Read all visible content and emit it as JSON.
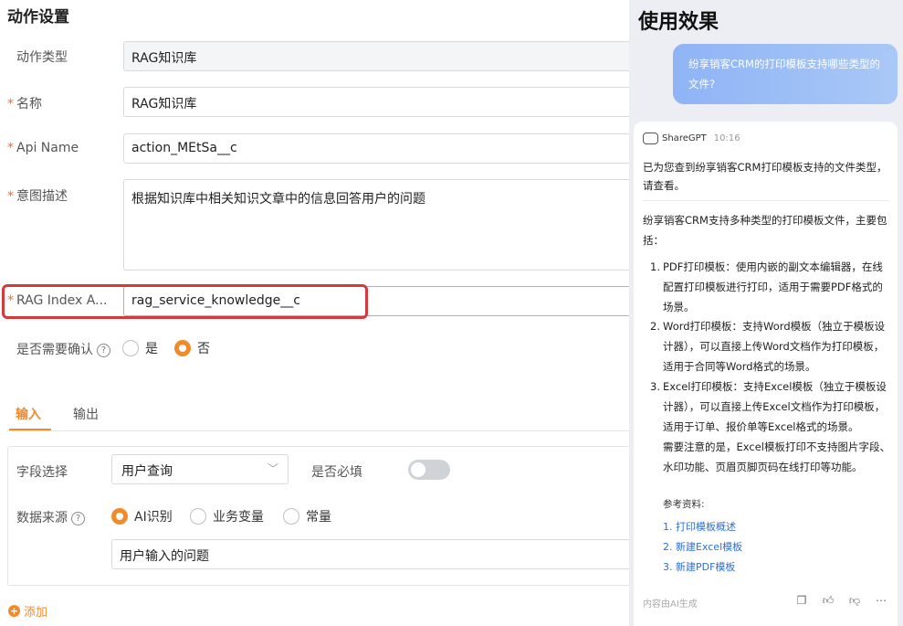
{
  "form": {
    "section_title": "动作设置",
    "rows": {
      "action_type": {
        "label": "动作类型",
        "value": "RAG知识库"
      },
      "name": {
        "label": "名称",
        "value": "RAG知识库"
      },
      "api_name": {
        "label": "Api Name",
        "value": "action_MEtSa__c"
      },
      "intent": {
        "label": "意图描述",
        "value": "根据知识库中相关知识文章中的信息回答用户的问题"
      },
      "rag_index": {
        "label": "RAG Index A...",
        "value": "rag_service_knowledge__c"
      }
    },
    "confirm": {
      "label": "是否需要确认",
      "options": [
        "是",
        "否"
      ],
      "selected": "否"
    },
    "tabs": [
      "输入",
      "输出"
    ],
    "active_tab": "输入",
    "field_select": {
      "label": "字段选择",
      "value": "用户查询"
    },
    "required": {
      "label": "是否必填",
      "on": false
    },
    "data_source": {
      "label": "数据来源",
      "options": [
        "AI识别",
        "业务变量",
        "常量"
      ],
      "selected": "AI识别",
      "value": "用户输入的问题"
    },
    "add_label": "添加",
    "required_mark": "*"
  },
  "chat": {
    "title": "使用效果",
    "user_message": "纷享销客CRM的打印模板支持哪些类型的文件?",
    "bot_name": "ShareGPT",
    "time": "10:16",
    "summary": "已为您查到纷享销客CRM打印模板支持的文件类型，请查看。",
    "intro": "纷享销客CRM支持多种类型的打印模板文件，主要包括：",
    "items": [
      "PDF打印模板：使用内嵌的副文本编辑器，在线配置打印模板进行打印，适用于需要PDF格式的场景。",
      "Word打印模板：支持Word模板（独立于模板设计器），可以直接上传Word文档作为打印模板，适用于合同等Word格式的场景。",
      "Excel打印模板：支持Excel模板（独立于模板设计器），可以直接上传Excel文档作为打印模板，适用于订单、报价单等Excel格式的场景。"
    ],
    "note": "需要注意的是，Excel模板打印不支持图片字段、水印功能、页眉页脚页码在线打印等功能。",
    "refs_title": "参考资料:",
    "refs": [
      "1. 打印模板概述",
      "2. 新建Excel模板",
      "3. 新建PDF模板"
    ],
    "ai_generated": "内容由AI生成",
    "accent_color": "#f38a2a",
    "link_color": "#2f6fd6"
  }
}
